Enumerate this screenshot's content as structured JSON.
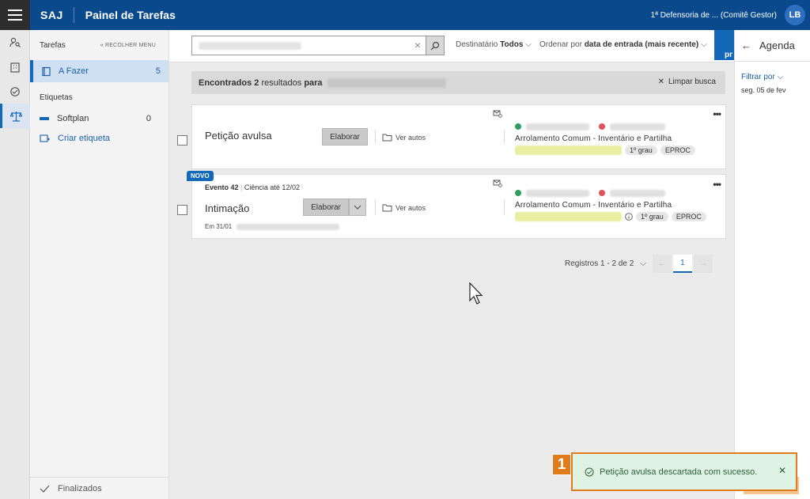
{
  "header": {
    "brand": "SAJ",
    "title": "Painel de Tarefas",
    "unit": "1ª Defensoria de ... (Comitê Gestor)",
    "avatar": "LB"
  },
  "sidebar": {
    "section_title": "Tarefas",
    "collapse_label": "RECOLHER MENU",
    "active_item": {
      "label": "A Fazer",
      "count": "5"
    },
    "labels_title": "Etiquetas",
    "tags": [
      {
        "label": "Softplan",
        "count": "0",
        "color": "#1468b8"
      }
    ],
    "create_label": "Criar etiqueta",
    "finished_label": "Finalizados"
  },
  "toolbar": {
    "recipient_label": "Destinatário",
    "recipient_value": "Todos",
    "order_label": "Ordenar por",
    "order_value": "data de entrada (mais recente)",
    "strip_text": "pr"
  },
  "results": {
    "prefix": "Encontrados",
    "count": "2",
    "middle": "resultados",
    "suffix": "para",
    "clear_label": "Limpar busca"
  },
  "cards": [
    {
      "kind": "Petição avulsa",
      "action": "Elaborar",
      "autos": "Ver autos",
      "class": "Arrolamento Comum - Inventário e Partilha",
      "degree": "1º grau",
      "system": "EPROC"
    },
    {
      "badge": "NOVO",
      "event": "Evento 42",
      "deadline": "Ciência até 12/02",
      "kind": "Intimação",
      "action": "Elaborar",
      "autos": "Ver autos",
      "date": "Em 31/01",
      "class": "Arrolamento Comum - Inventário e Partilha",
      "degree": "1º grau",
      "system": "EPROC"
    }
  ],
  "pager": {
    "label": "Registros 1 - 2 de 2",
    "current": "1"
  },
  "agenda": {
    "title": "Agenda",
    "filter": "Filtrar por",
    "date": "seg. 05 de fev"
  },
  "toast": {
    "step": "1",
    "message": "Petição avulsa descartada com sucesso."
  },
  "colors": {
    "primary": "#0a4a8c",
    "accent": "#1468b8",
    "success_bg": "#dff3e4",
    "highlight": "#e07b1a"
  }
}
